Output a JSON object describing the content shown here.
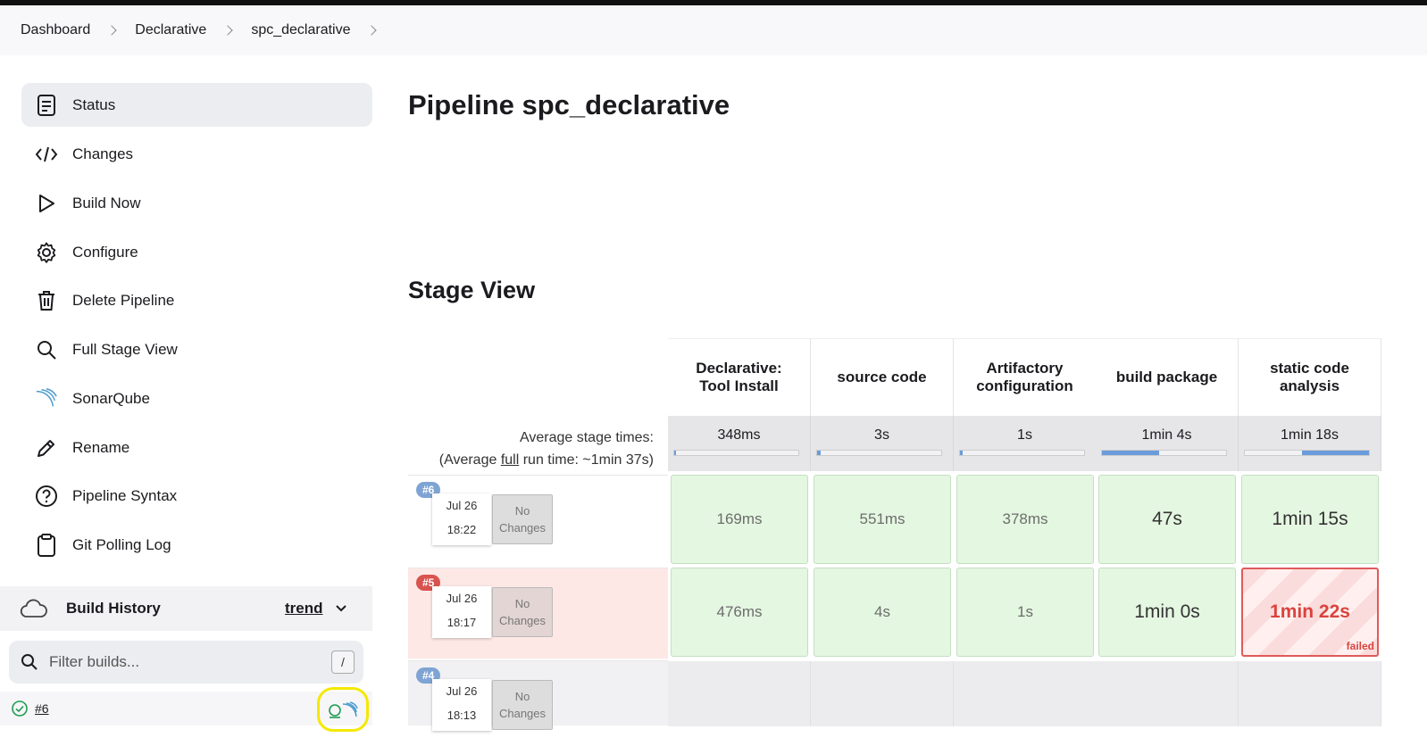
{
  "breadcrumb": [
    "Dashboard",
    "Declarative",
    "spc_declarative"
  ],
  "sidebar": {
    "items": [
      {
        "label": "Status",
        "icon": "status-icon"
      },
      {
        "label": "Changes",
        "icon": "code-icon"
      },
      {
        "label": "Build Now",
        "icon": "play-icon"
      },
      {
        "label": "Configure",
        "icon": "gear-icon"
      },
      {
        "label": "Delete Pipeline",
        "icon": "trash-icon"
      },
      {
        "label": "Full Stage View",
        "icon": "search-icon"
      },
      {
        "label": "SonarQube",
        "icon": "sonarqube-icon"
      },
      {
        "label": "Rename",
        "icon": "pencil-icon"
      },
      {
        "label": "Pipeline Syntax",
        "icon": "help-icon"
      },
      {
        "label": "Git Polling Log",
        "icon": "clipboard-icon"
      }
    ]
  },
  "build_history": {
    "title": "Build History",
    "trend": "trend",
    "filter_placeholder": "Filter builds...",
    "shortcut": "/",
    "builds": [
      {
        "label": "#6",
        "status": "success"
      }
    ]
  },
  "main": {
    "title": "Pipeline spc_declarative",
    "stage_view_title": "Stage View",
    "avg_label_line1": "Average stage times:",
    "avg_label_prefix": "(Average ",
    "avg_label_link": "full",
    "avg_label_suffix": " run time: ~1min 37s)"
  },
  "stages": [
    {
      "name": "Declarative: Tool Install",
      "avg": "348ms",
      "avg_fraction": 0.01
    },
    {
      "name": "source code",
      "avg": "3s",
      "avg_fraction": 0.03
    },
    {
      "name": "Artifactory configuration",
      "avg": "1s",
      "avg_fraction": 0.02
    },
    {
      "name": "build package",
      "avg": "1min 4s",
      "avg_fraction": 0.46
    },
    {
      "name": "static code analysis",
      "avg": "1min 18s",
      "avg_fraction": 0.54
    }
  ],
  "runs": [
    {
      "id": "#6",
      "date": "Jul 26",
      "time": "18:22",
      "changes": [
        "No",
        "Changes"
      ],
      "status": "success",
      "cells": [
        "169ms",
        "551ms",
        "378ms",
        "47s",
        "1min 15s"
      ]
    },
    {
      "id": "#5",
      "date": "Jul 26",
      "time": "18:17",
      "changes": [
        "No",
        "Changes"
      ],
      "status": "failed",
      "cells": [
        "476ms",
        "4s",
        "1s",
        "1min 0s",
        "1min 22s"
      ],
      "failed_label": "failed"
    },
    {
      "id": "#4",
      "date": "Jul 26",
      "time": "18:13",
      "changes": [
        "No",
        "Changes"
      ],
      "status": "success",
      "cells": [
        "",
        "",
        "",
        "",
        ""
      ]
    }
  ],
  "colors": {
    "success_cell": "#e4f7e1",
    "failed_cell": "#fbdcdc",
    "accent_blue": "#6a9cdc",
    "highlight": "#f5e800"
  }
}
